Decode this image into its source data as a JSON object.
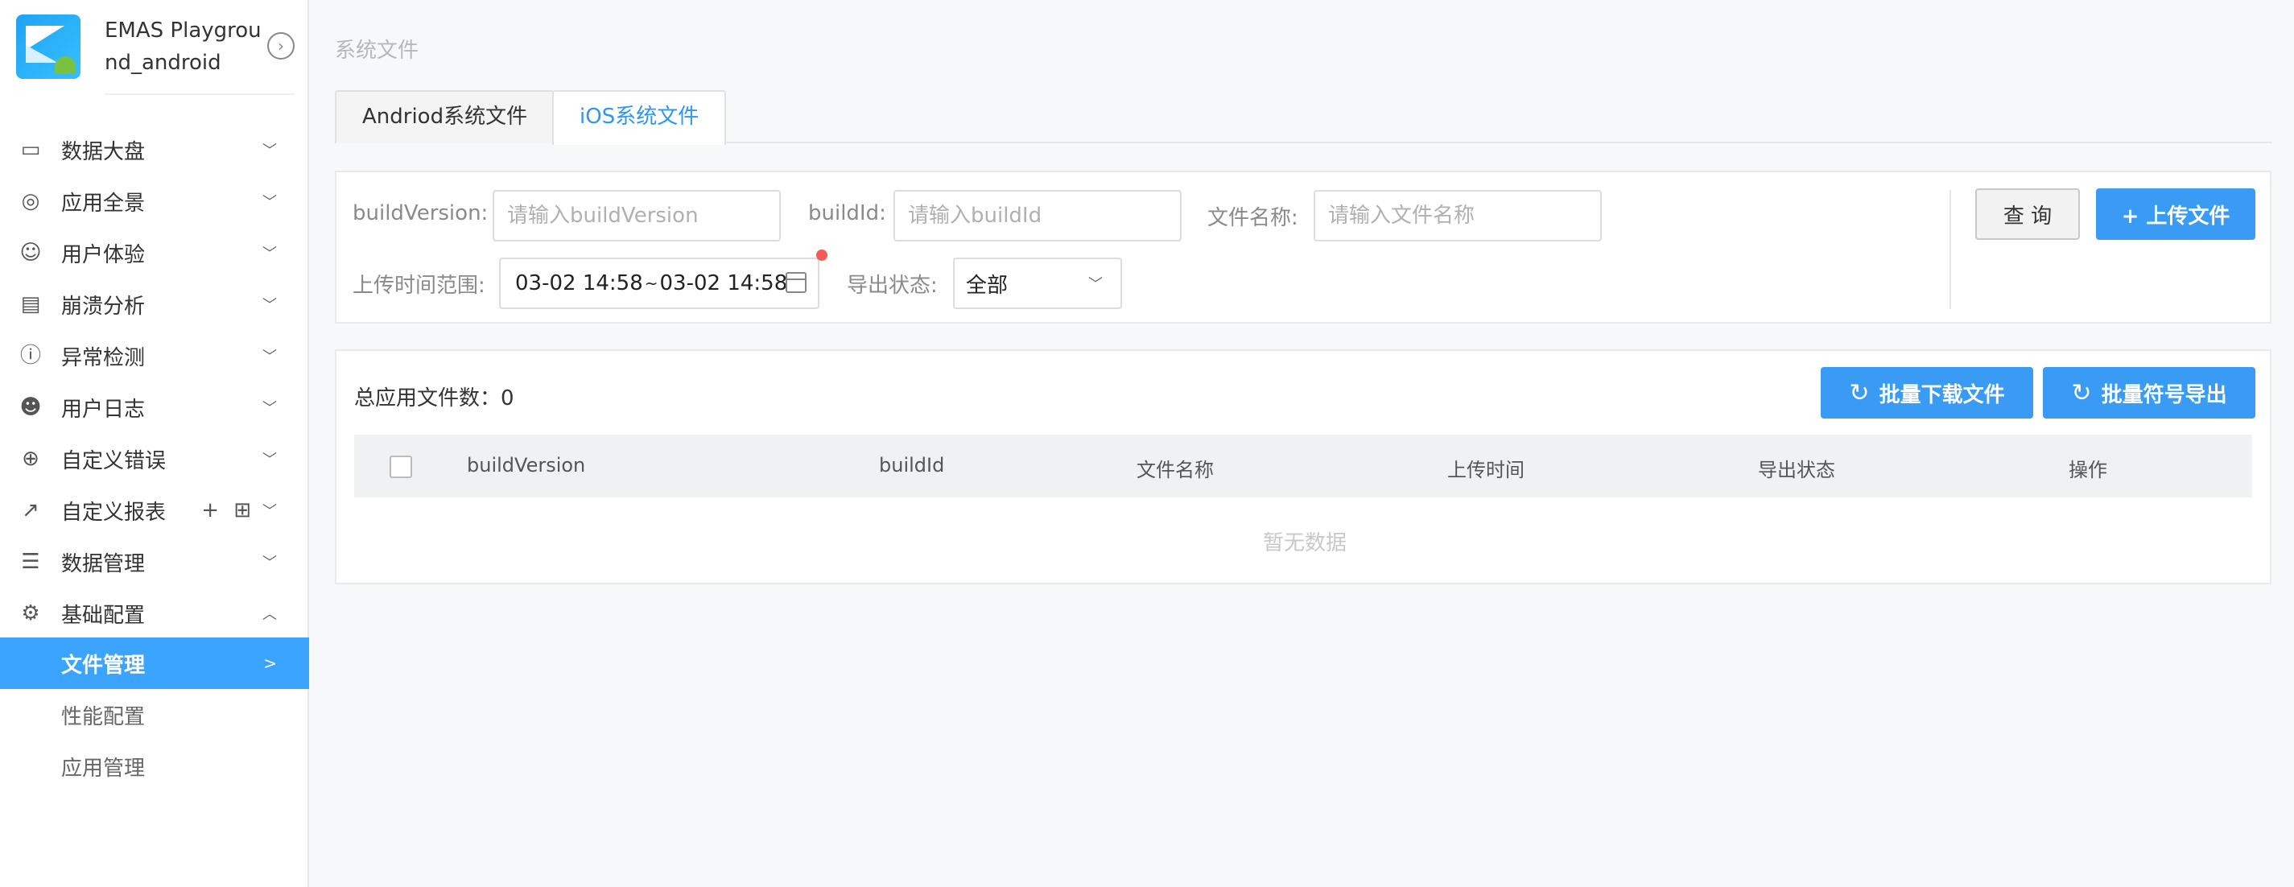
{
  "app": {
    "name": "EMAS Playground_android",
    "collapse_icon": "chevron-right-circle-icon"
  },
  "sidebar": {
    "items": [
      {
        "label": "数据大盘",
        "icon": "dashboard-icon",
        "glyph": "▭",
        "expanded": false
      },
      {
        "label": "应用全景",
        "icon": "globe-icon",
        "glyph": "◎",
        "expanded": false
      },
      {
        "label": "用户体验",
        "icon": "user-icon",
        "glyph": "☺",
        "expanded": false
      },
      {
        "label": "崩溃分析",
        "icon": "crash-report-icon",
        "glyph": "▤",
        "expanded": false
      },
      {
        "label": "异常检测",
        "icon": "alert-circle-icon",
        "glyph": "ⓘ",
        "expanded": false
      },
      {
        "label": "用户日志",
        "icon": "user-log-icon",
        "glyph": "☻",
        "expanded": false
      },
      {
        "label": "自定义错误",
        "icon": "target-icon",
        "glyph": "⊕",
        "expanded": false
      },
      {
        "label": "自定义报表",
        "icon": "line-chart-icon",
        "glyph": "↗",
        "expanded": false,
        "extras": [
          "+",
          "⊞"
        ]
      },
      {
        "label": "数据管理",
        "icon": "database-icon",
        "glyph": "☰",
        "expanded": false
      },
      {
        "label": "基础配置",
        "icon": "settings-gear-icon",
        "glyph": "⚙",
        "expanded": true
      }
    ],
    "sub_items": [
      {
        "label": "文件管理",
        "active": true,
        "chevron": ">"
      },
      {
        "label": "性能配置",
        "active": false
      },
      {
        "label": "应用管理",
        "active": false
      }
    ]
  },
  "breadcrumb": "系统文件",
  "tabs": [
    {
      "label": "Andriod系统文件",
      "active": false
    },
    {
      "label": "iOS系统文件",
      "active": true
    }
  ],
  "filters": {
    "build_version": {
      "label": "buildVersion:",
      "placeholder": "请输入buildVersion",
      "value": ""
    },
    "build_id": {
      "label": "buildId:",
      "placeholder": "请输入buildId",
      "value": ""
    },
    "file_name": {
      "label": "文件名称:",
      "placeholder": "请输入文件名称",
      "value": ""
    },
    "upload_time": {
      "label": "上传时间范围:",
      "start": "03-02 14:58",
      "separator": "~",
      "end": "03-02 14:58"
    },
    "export_status": {
      "label": "导出状态:",
      "value": "全部"
    },
    "query_label": "查 询",
    "upload_label": "+ 上传文件"
  },
  "list": {
    "total_label": "总应用文件数：",
    "total_count": "0",
    "batch_download_label": "批量下载文件",
    "batch_export_label": "批量符号导出",
    "refresh_glyph": "↻",
    "columns": [
      "buildVersion",
      "buildId",
      "文件名称",
      "上传时间",
      "导出状态",
      "操作"
    ],
    "empty_text": "暂无数据"
  },
  "colors": {
    "primary": "#3a9bf5",
    "active_nav": "#3ba4ff",
    "alert_dot": "#f25c54"
  }
}
